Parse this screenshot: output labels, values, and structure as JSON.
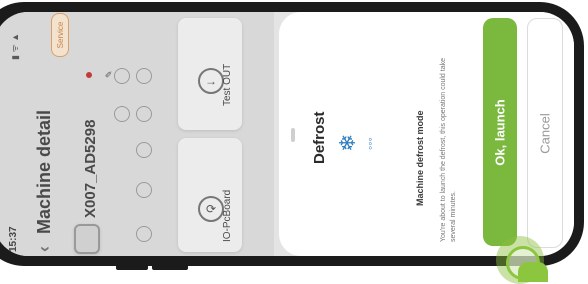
{
  "status": {
    "time": "15:37"
  },
  "header": {
    "title": "Machine detail",
    "machine_id": "X007_AD5298",
    "badge": "Service"
  },
  "cards": [
    {
      "label": "IO-PcBoard",
      "icon": "refresh-icon"
    },
    {
      "label": "Test OUT",
      "icon": "arrow-right-circle-icon"
    }
  ],
  "sheet": {
    "title": "Defrost",
    "icon": "snowflake-drops-icon",
    "subtitle": "Machine defrost mode",
    "description": "You're about to launch the defrost, this operation could take several minutes.",
    "ok_label": "Ok, launch",
    "cancel_label": "Cancel"
  },
  "colors": {
    "accent": "#7ab83e",
    "badge": "#c7844a",
    "status_dot": "#c43a3a"
  }
}
